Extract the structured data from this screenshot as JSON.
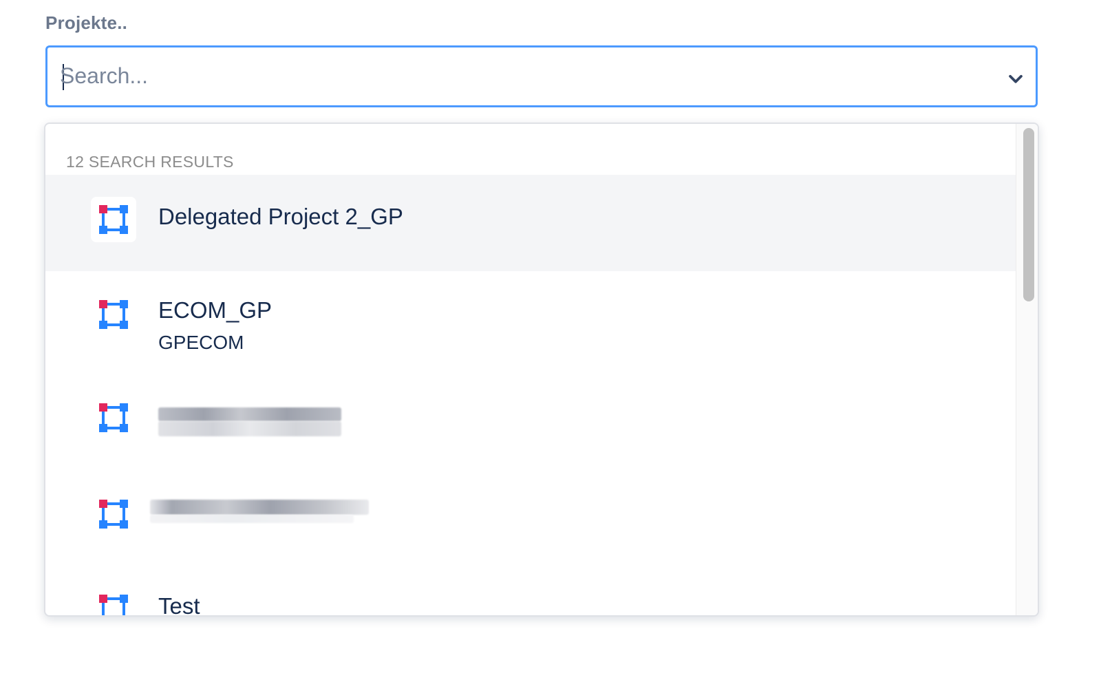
{
  "field": {
    "label": "Projekte.."
  },
  "search": {
    "placeholder": "Search...",
    "value": ""
  },
  "colors": {
    "focus_border": "#4c9aff",
    "text_primary": "#172b4d",
    "icon_red": "#e2275d",
    "icon_blue": "#2684ff"
  },
  "results": {
    "heading": "12 SEARCH RESULTS",
    "options": [
      {
        "title": "Delegated Project 2_GP",
        "subtitle": "",
        "icon": "project-icon",
        "active": true
      },
      {
        "title": "ECOM_GP",
        "subtitle": "GPECOM",
        "icon": "project-icon",
        "active": false
      },
      {
        "title": "",
        "subtitle": "",
        "icon": "project-icon",
        "active": false,
        "redacted": true
      },
      {
        "title": "",
        "subtitle": "",
        "icon": "project-icon",
        "active": false,
        "redacted": true
      },
      {
        "title": "Test",
        "subtitle": "",
        "icon": "project-icon",
        "active": false
      }
    ]
  }
}
